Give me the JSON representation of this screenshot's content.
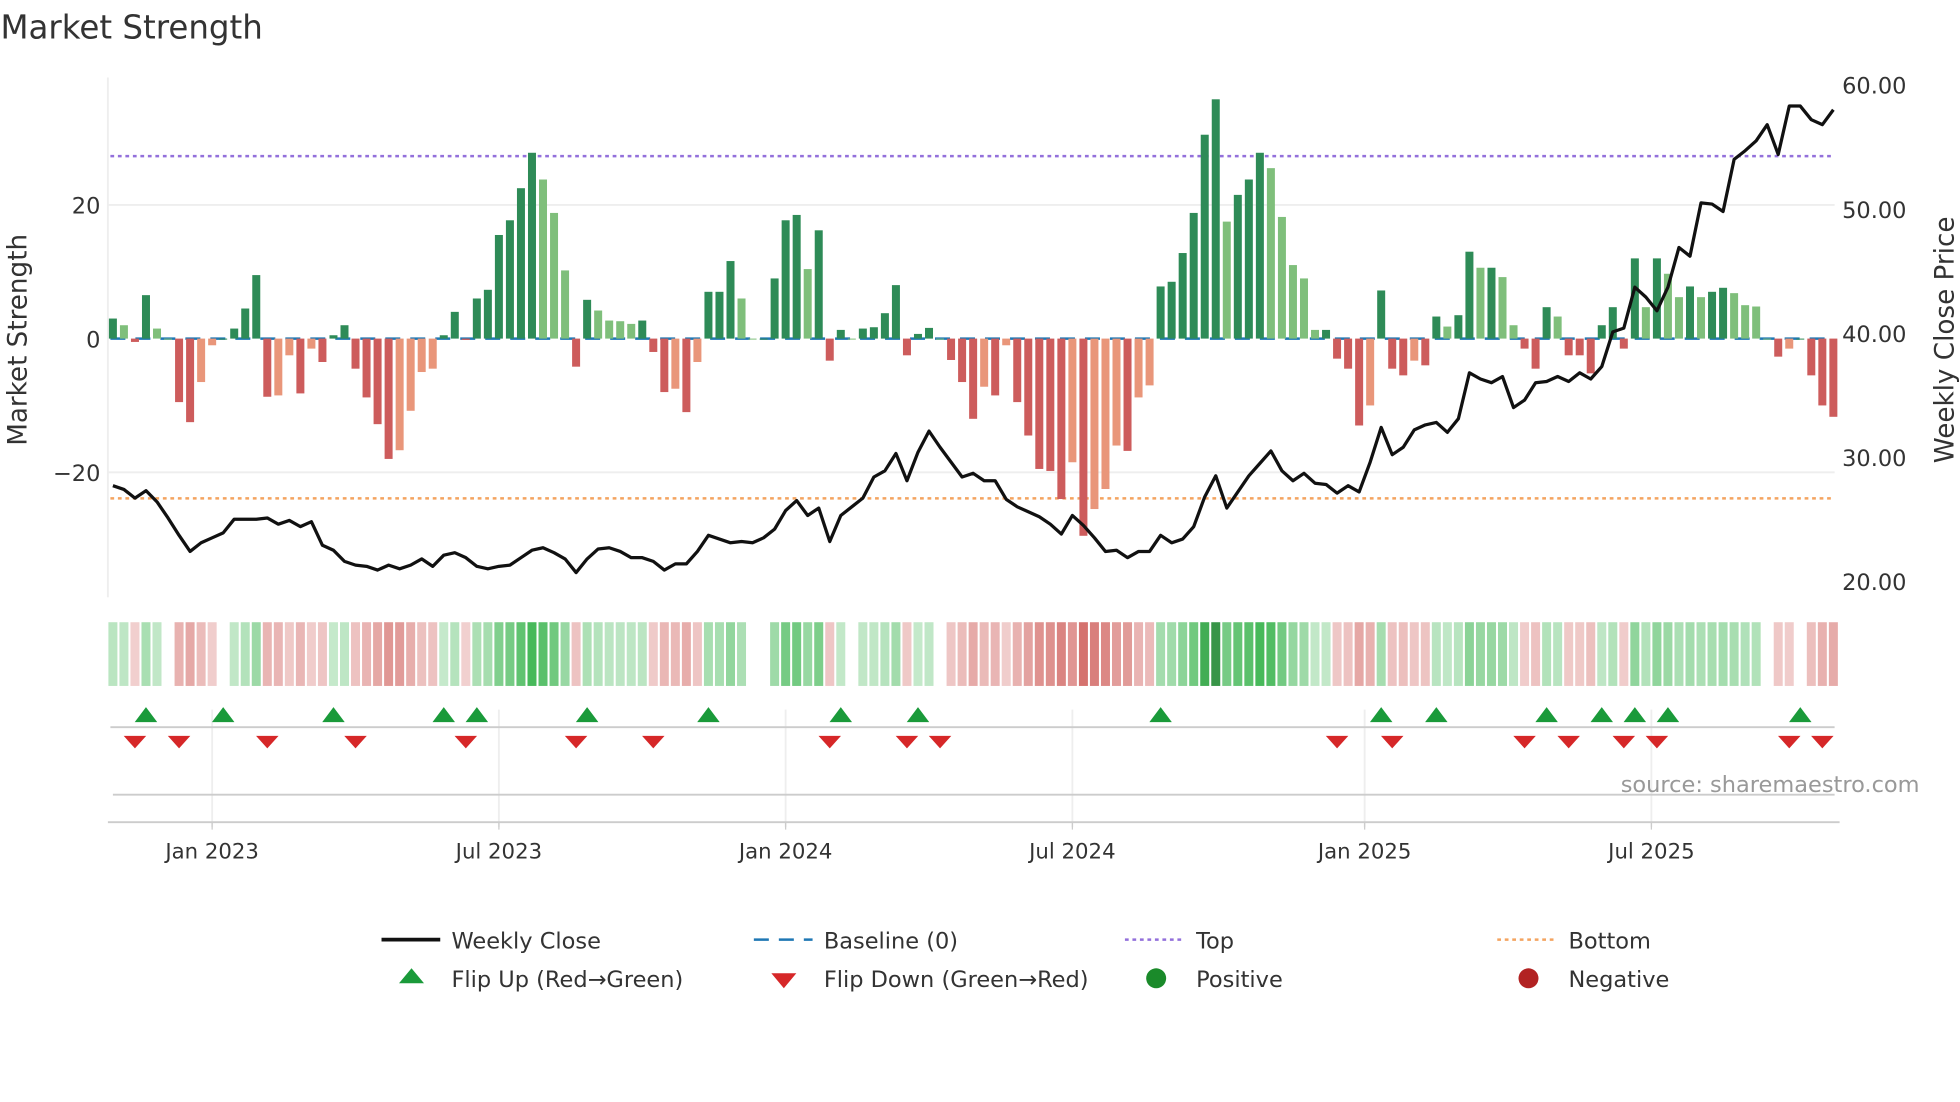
{
  "chart_data": {
    "type": "bar+line",
    "title": "Market Strength",
    "ylabel_left": "Market Strength",
    "ylabel_right": "Weekly Close Price",
    "ylim_left": [
      -38.5,
      38.5
    ],
    "ylim_right": [
      20,
      60
    ],
    "left_ticks": [
      {
        "v": 20,
        "label": "20"
      },
      {
        "v": 0,
        "label": "0"
      },
      {
        "v": -20,
        "label": "−20"
      }
    ],
    "right_ticks": [
      {
        "v": 60,
        "label": "60.00"
      },
      {
        "v": 50,
        "label": "50.00"
      },
      {
        "v": 40,
        "label": "40.00"
      },
      {
        "v": 30,
        "label": "30.00"
      },
      {
        "v": 20,
        "label": "20.00"
      }
    ],
    "x_ticks": [
      {
        "week": 9,
        "label": "Jan 2023"
      },
      {
        "week": 35,
        "label": "Jul 2023"
      },
      {
        "week": 61,
        "label": "Jan 2024"
      },
      {
        "week": 87,
        "label": "Jul 2024"
      },
      {
        "week": 113.5,
        "label": "Jan 2025"
      },
      {
        "week": 139.5,
        "label": "Jul 2025"
      }
    ],
    "top_level": 27.3,
    "bottom_level": -23.9,
    "strength": [
      3,
      2,
      -0.5,
      6.5,
      1.5,
      0,
      -9.5,
      -12.5,
      -6.5,
      -1,
      0,
      1.5,
      4.5,
      9.5,
      -8.7,
      -8.5,
      -2.5,
      -8.2,
      -1.5,
      -3.5,
      0.5,
      2,
      -4.5,
      -8.8,
      -12.8,
      -18,
      -16.7,
      -10.8,
      -5,
      -4.5,
      0.5,
      4,
      -0.2,
      6,
      7.3,
      15.5,
      17.7,
      22.5,
      27.8,
      23.8,
      18.8,
      10.2,
      -4.2,
      5.8,
      4.2,
      2.7,
      2.6,
      2.2,
      2.7,
      -2,
      -8,
      -7.5,
      -11,
      -3.5,
      7,
      7,
      11.6,
      6,
      0,
      0,
      9,
      17.7,
      18.5,
      10.4,
      16.2,
      -3.3,
      1.3,
      0,
      1.5,
      1.7,
      3.8,
      8,
      -2.5,
      0.7,
      1.6,
      0,
      -3.2,
      -6.5,
      -12,
      -7.2,
      -8.5,
      -1,
      -9.5,
      -14.5,
      -19.5,
      -19.8,
      -24,
      -18.5,
      -29.5,
      -25.5,
      -22.5,
      -16,
      -16.8,
      -8.8,
      -7,
      7.8,
      8.5,
      12.8,
      18.8,
      30.5,
      35.8,
      17.5,
      21.5,
      23.8,
      27.8,
      25.5,
      18.2,
      11,
      9,
      1.3,
      1.3,
      -3,
      -4.5,
      -13,
      -10,
      7.2,
      -4.5,
      -5.5,
      -3.3,
      -4,
      3.3,
      1.8,
      3.5,
      13,
      10.6,
      10.6,
      9.2,
      2,
      -1.5,
      -4.5,
      4.7,
      3.3,
      -2.5,
      -2.5,
      -5.2,
      2,
      4.7,
      -1.5,
      12,
      4.7,
      12,
      9.7,
      6.2,
      7.8,
      6.2,
      7,
      7.6,
      6.8,
      5,
      4.8,
      0,
      -2.7,
      -1.5,
      0,
      -5.5,
      -10,
      -11.7
    ],
    "weekly_close": [
      27.7,
      27.4,
      26.7,
      27.3,
      26.4,
      25.1,
      23.7,
      22.4,
      23.1,
      23.5,
      23.9,
      25.0,
      25.0,
      25.0,
      25.1,
      24.6,
      24.9,
      24.4,
      24.8,
      22.9,
      22.5,
      21.6,
      21.3,
      21.2,
      20.9,
      21.3,
      21.0,
      21.3,
      21.8,
      21.2,
      22.1,
      22.3,
      21.9,
      21.2,
      21.0,
      21.2,
      21.3,
      21.9,
      22.5,
      22.7,
      22.3,
      21.8,
      20.7,
      21.8,
      22.6,
      22.7,
      22.4,
      21.9,
      21.9,
      21.6,
      20.9,
      21.4,
      21.4,
      22.4,
      23.7,
      23.4,
      23.1,
      23.2,
      23.1,
      23.5,
      24.2,
      25.7,
      26.5,
      25.3,
      25.9,
      23.2,
      25.3,
      26.0,
      26.7,
      28.4,
      28.9,
      30.3,
      28.1,
      30.4,
      32.1,
      30.8,
      29.6,
      28.4,
      28.7,
      28.1,
      28.1,
      26.6,
      26.0,
      25.6,
      25.2,
      24.6,
      23.8,
      25.3,
      24.5,
      23.5,
      22.4,
      22.5,
      21.9,
      22.4,
      22.4,
      23.7,
      23.1,
      23.4,
      24.4,
      26.8,
      28.5,
      25.9,
      27.2,
      28.5,
      29.5,
      30.5,
      28.9,
      28.1,
      28.7,
      27.9,
      27.8,
      27.1,
      27.7,
      27.2,
      29.6,
      32.4,
      30.2,
      30.8,
      32.2,
      32.6,
      32.8,
      32.0,
      33.1,
      36.8,
      36.3,
      36.0,
      36.5,
      34.0,
      34.6,
      36.0,
      36.1,
      36.5,
      36.1,
      36.8,
      36.3,
      37.3,
      40.1,
      40.4,
      43.7,
      42.9,
      41.8,
      43.7,
      46.9,
      46.2,
      50.5,
      50.4,
      49.8,
      54.0,
      54.7,
      55.5,
      56.8,
      54.4,
      58.3,
      58.3,
      57.2,
      56.8,
      58.0
    ],
    "flip_up_weeks": [
      3,
      10,
      20,
      30,
      33,
      43,
      54,
      66,
      73,
      95,
      115,
      120,
      130,
      135,
      138,
      141,
      153
    ],
    "flip_down_weeks": [
      2,
      6,
      14,
      22,
      32,
      42,
      49,
      65,
      72,
      75,
      111,
      116,
      128,
      132,
      137,
      140,
      152,
      155
    ],
    "legend": {
      "weekly_close": "Weekly Close",
      "baseline": "Baseline (0)",
      "top": "Top",
      "bottom": "Bottom",
      "flip_up": "Flip Up (Red→Green)",
      "flip_down": "Flip Down (Green→Red)",
      "positive": "Positive",
      "negative": "Negative"
    },
    "legend_placement": "bottom",
    "source": "source: sharemaestro.com",
    "colors": {
      "strong_pos": "#2e8b57",
      "weak_pos": "#7fbf7b",
      "strong_neg": "#cd5c5c",
      "weak_neg": "#e9967a",
      "line": "#111111",
      "baseline": "#1f77b4",
      "top": "#9370db",
      "bottom": "#f4a460",
      "flip_up": "#1a9a3a",
      "flip_down": "#d62728",
      "positive": "#1a8a2a",
      "negative": "#b22222"
    }
  }
}
